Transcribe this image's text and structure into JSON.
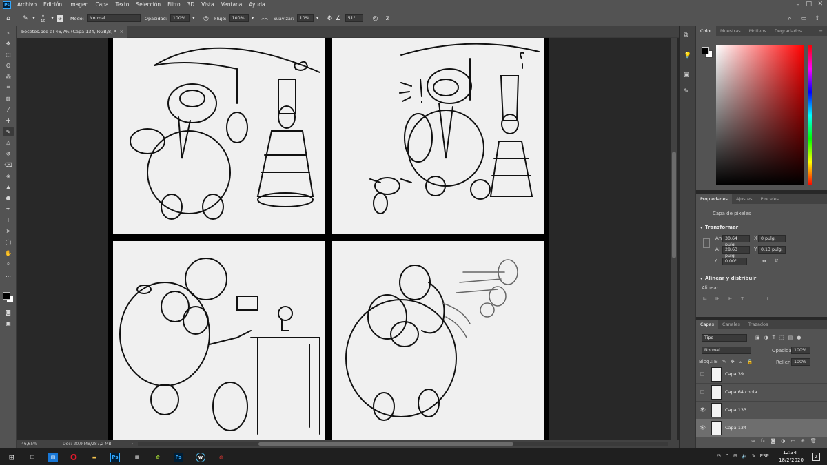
{
  "menubar": {
    "logo": "Ps",
    "items": [
      "Archivo",
      "Edición",
      "Imagen",
      "Capa",
      "Texto",
      "Selección",
      "Filtro",
      "3D",
      "Vista",
      "Ventana",
      "Ayuda"
    ]
  },
  "options": {
    "brush_size": "10",
    "mode_label": "Modo:",
    "mode_value": "Normal",
    "opacity_label": "Opacidad:",
    "opacity_value": "100%",
    "flow_label": "Flujo:",
    "flow_value": "100%",
    "smooth_label": "Suavizar:",
    "smooth_value": "10%",
    "angle_value": "51°"
  },
  "document": {
    "tab_title": "bocetos.psd al 46,7% (Capa 134, RGB/8) *",
    "tab_close": "×"
  },
  "status": {
    "zoom": "46,65%",
    "doc": "Doc: 20,9 MB/287,2 MB"
  },
  "color_panel": {
    "tabs": [
      "Color",
      "Muestras",
      "Motivos",
      "Degradados"
    ],
    "foreground": "#000000",
    "background": "#ffffff",
    "hue_color": "#ff0000"
  },
  "properties": {
    "tabs": [
      "Propiedades",
      "Ajustes",
      "Pinceles"
    ],
    "kind": "Capa de píxeles",
    "transform_title": "Transformar",
    "w_label": "An",
    "w_value": "30,64 pulg",
    "h_label": "Al",
    "h_value": "28,63 pulg",
    "x_label": "X",
    "x_value": "0 pulg.",
    "y_label": "Y",
    "y_value": "0,13 pulg.",
    "angle": "0,00°",
    "align_title": "Alinear y distribuir",
    "align_label": "Alinear:"
  },
  "layers": {
    "tabs": [
      "Capas",
      "Canales",
      "Trazados"
    ],
    "filter": "Tipo",
    "blend": "Normal",
    "opacity_label": "Opacidad:",
    "opacity_value": "100%",
    "lock_label": "Bloq.:",
    "fill_label": "Relleno:",
    "fill_value": "100%",
    "items": [
      {
        "name": "Capa 39",
        "visible": false
      },
      {
        "name": "Capa 64 copia",
        "visible": false
      },
      {
        "name": "Capa 133",
        "visible": true
      },
      {
        "name": "Capa 134",
        "visible": true,
        "selected": true
      }
    ],
    "footer": "fx"
  },
  "taskbar": {
    "ps_label": "Ps",
    "lang": "ESP",
    "time": "12:34",
    "date": "18/2/2020",
    "notif": "2"
  }
}
